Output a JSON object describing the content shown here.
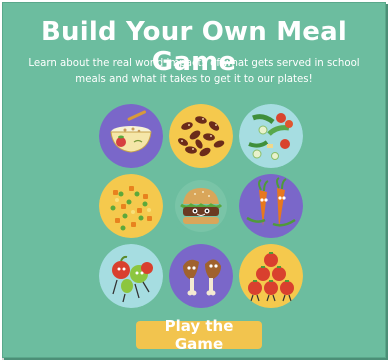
{
  "header": {
    "title": "Build Your Own Meal Game",
    "subtitle": "Learn about the real world impacts of what gets served in school meals and what it takes to get it to our plates!"
  },
  "food_tiles": [
    {
      "icon": "yogurt-bowl-icon",
      "background": "#7a67c9"
    },
    {
      "icon": "beans-icon",
      "background": "#f5c94d"
    },
    {
      "icon": "salad-icon",
      "background": "#a6dde1"
    },
    {
      "icon": "mixed-vegetables-icon",
      "background": "#f5c94d"
    },
    {
      "icon": "burger-character-icon",
      "background": "#6cbd9f"
    },
    {
      "icon": "carrot-characters-icon",
      "background": "#7a67c9"
    },
    {
      "icon": "fruit-characters-icon",
      "background": "#a6dde1"
    },
    {
      "icon": "chicken-drumsticks-icon",
      "background": "#7a67c9"
    },
    {
      "icon": "tomato-pyramid-icon",
      "background": "#f5c94d"
    }
  ],
  "cta": {
    "label": "Play the Game"
  },
  "colors": {
    "card_background": "#6cbd9f",
    "button": "#f2c44e",
    "purple": "#7a67c9",
    "yellow": "#f5c94d",
    "light_blue": "#a6dde1"
  }
}
